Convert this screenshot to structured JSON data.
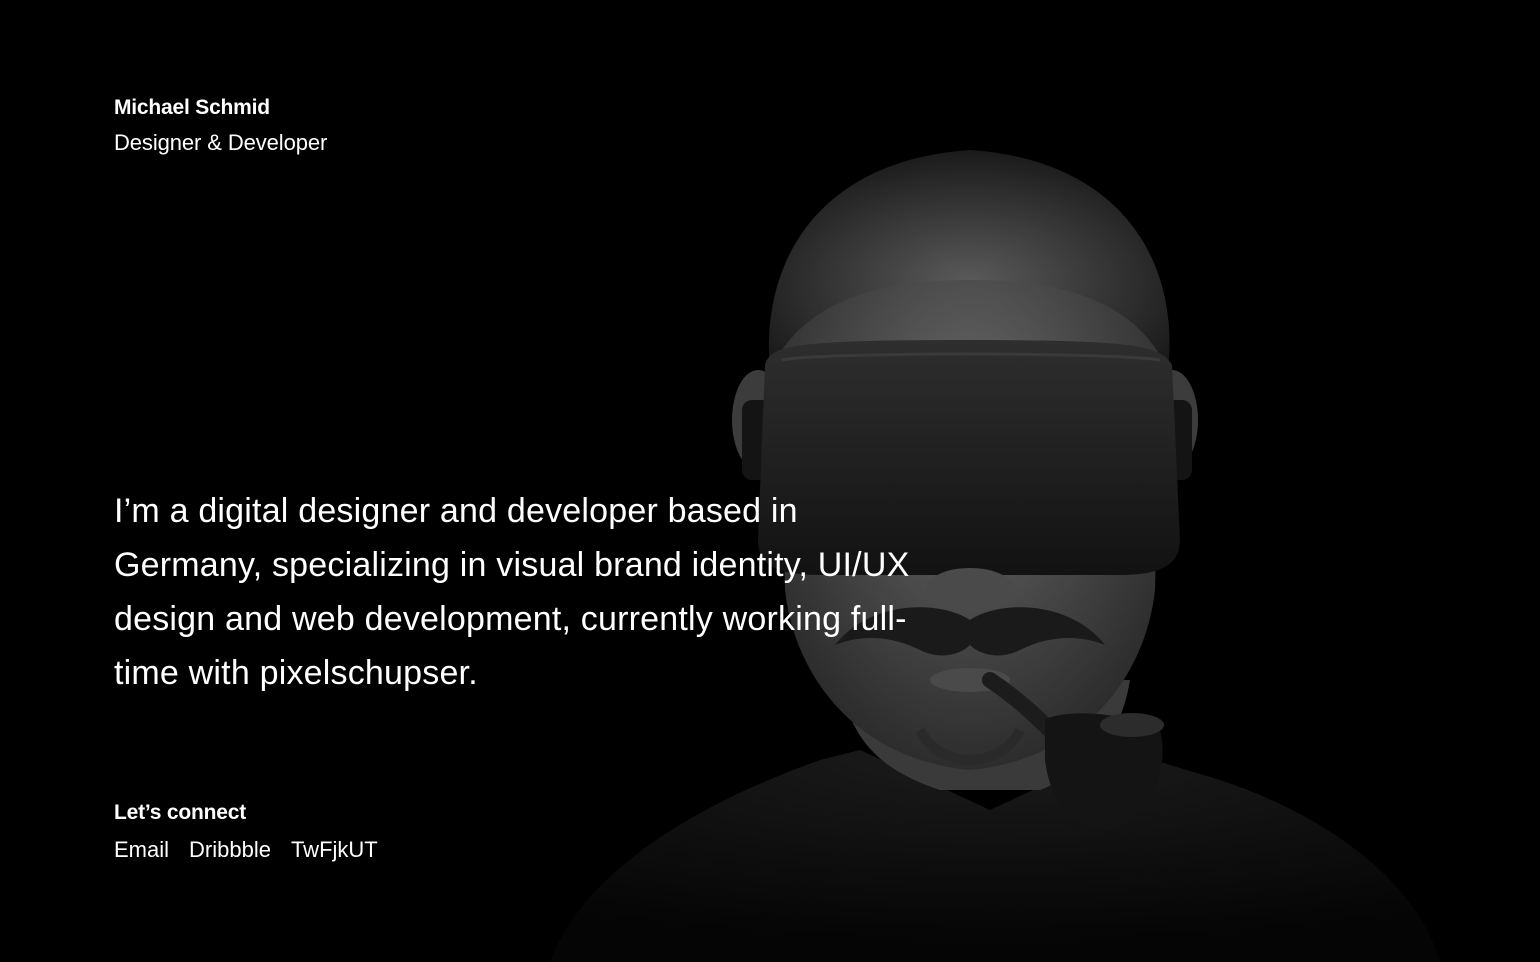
{
  "header": {
    "name": "Michael Schmid",
    "role": "Designer & Developer"
  },
  "intro": {
    "text": "I’m a digital designer and developer based in Germany, specializing in visual brand identity, UI/UX design and web development, currently working full-time with pixelschupser."
  },
  "connect": {
    "title": "Let’s connect",
    "links": [
      {
        "label": "Email"
      },
      {
        "label": "Dribbble"
      },
      {
        "label": "TwFjkUT"
      }
    ]
  },
  "colors": {
    "background": "#000000",
    "text": "#ffffff"
  }
}
